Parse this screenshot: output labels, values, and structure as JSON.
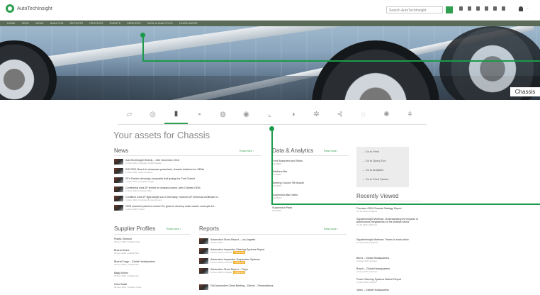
{
  "app": {
    "logo_text": "AutoTechInsight",
    "search_placeholder": "Search AutoTechInsight",
    "user_label": "···"
  },
  "nav": [
    "Home",
    "Feed",
    "News",
    "Analysis",
    "Reports",
    "Profiles",
    "Events",
    "Services",
    "Data & Analytics",
    "Learn More"
  ],
  "hero": {
    "badge": "Chassis"
  },
  "assets_title": "Your assets for Chassis",
  "news": {
    "heading": "News",
    "read_more": "Read more ›",
    "items": [
      {
        "title": "AutoTechInsight Weekly – 13th December 2016",
        "meta": "15 Dec 2016 | Supplier Insight Weekly"
      },
      {
        "title": "IDS 2020: Bosch to showcase powertrain, chassis solutions for OEMs",
        "meta": "15 Dec 2016 | New Products"
      },
      {
        "title": "ZF's Tachlon develops composite leaf springs for Ford Transit",
        "meta": "14 Dec 2016 | Supplier Insight"
      },
      {
        "title": "Continental wins ZF tender for chassis control, wins Chinese OEM",
        "meta": "13 Dec 2016 | Contract Win"
      },
      {
        "title": "Contitech wins ZF light-weight car in Germany; received ZF technical certificate in...",
        "meta": "12 Dec 2016 | Contract Announcement"
      },
      {
        "title": "OEM research partners receive EU grant to develop under-carrier concepts for...",
        "meta": "12 Dec 2016 | Grant"
      }
    ]
  },
  "data_analytics": {
    "heading": "Data & Analytics",
    "read_more": "Read more ›",
    "items": [
      {
        "title": "Front Absorbent and Struts",
        "meta": "CHASSIS"
      },
      {
        "title": "Stabilizer Bar",
        "meta": "CHASSIS"
      },
      {
        "title": "Steering Column Tilt Module",
        "meta": "CHASSIS"
      },
      {
        "title": "Suspension Ball Joints",
        "meta": "CHASSIS"
      },
      {
        "title": "Suspension Parts",
        "meta": "CHASSIS"
      }
    ]
  },
  "quick_links": [
    "Go to Feed",
    "Go to Query Tool",
    "Go to Analytics",
    "Go to Feed Tracker"
  ],
  "recently_viewed": {
    "heading": "Recently Viewed",
    "items": [
      {
        "title": "Premium OEM Chassis Strategy Report",
        "meta": "22 Jul 2016 | Analysis"
      },
      {
        "title": "SupplierInsight Webinar: Understanding the impacts of autonomous megatrends on the chassis sector",
        "meta": "21 Jul 2016 | Webinar"
      },
      {
        "title": "SupplierInsight Webinar: Trends in motor drive",
        "meta": "19 Sep 2016 | Webinar"
      },
      {
        "title": "Benni – Global Headquarters",
        "meta": "19 Aug 2016 | Europe"
      },
      {
        "title": "Bosch – Global Headquarters",
        "meta": "19 Sep 2016 | Europe"
      },
      {
        "title": "Power Steering Systems Market Report",
        "meta": "14 Nov 2016 | Report"
      },
      {
        "title": "Valeo – Global Headquarters",
        "meta": ""
      }
    ]
  },
  "supplier_profiles": {
    "heading": "Supplier Profiles",
    "read_more": "Read more ›",
    "items": [
      {
        "title": "Plastic Omnium",
        "meta": "08 Dec 2016 | Global Chain"
      },
      {
        "title": "Bharat Gears",
        "meta": "06 Dec 2016 | Global Asia"
      },
      {
        "title": "Bharat Forge – Global Headquarters",
        "meta": "06 Dec 2016 | Global Asia"
      },
      {
        "title": "Bajaj Motors",
        "meta": "06 Dec 2016 | Global Asia"
      },
      {
        "title": "Koito Battle",
        "meta": "06 Dec 2016 | Greater China"
      }
    ]
  },
  "reports": {
    "heading": "Reports",
    "read_more": "Read more ›",
    "items": [
      {
        "title": "Automotive Show Report – Los Angeles",
        "meta": "22 Nov 2016",
        "tag": ""
      },
      {
        "title": "Automotive Inspection Steering Systems Report",
        "meta": "22 Nov 2016 | Chassis",
        "tag": "PREMIUM"
      },
      {
        "title": "Automotive Inspection Suspension Systems",
        "meta": "22 Nov 2016 | Chassis",
        "tag": "PREMIUM"
      },
      {
        "title": "Automotive Show Report – Tokyo",
        "meta": "18 Nov 2016 | Chassis",
        "tag": "PREMIUM"
      },
      {
        "title": "Fall Automotive Client Briefing – Detroit – Presentations",
        "meta": "",
        "tag": ""
      }
    ]
  },
  "tab_icons": [
    "car-icon",
    "steering-icon",
    "chassis-icon",
    "engine-icon",
    "wheel-icon",
    "gear-icon",
    "seat-icon",
    "light-icon",
    "fan-icon",
    "key-icon",
    "battery-icon",
    "settings-icon",
    "plug-icon"
  ],
  "colors": {
    "accent": "#2e9e4f",
    "nav": "#5a6b57",
    "callout": "#1a9a4a",
    "tag": "#f2b233"
  }
}
